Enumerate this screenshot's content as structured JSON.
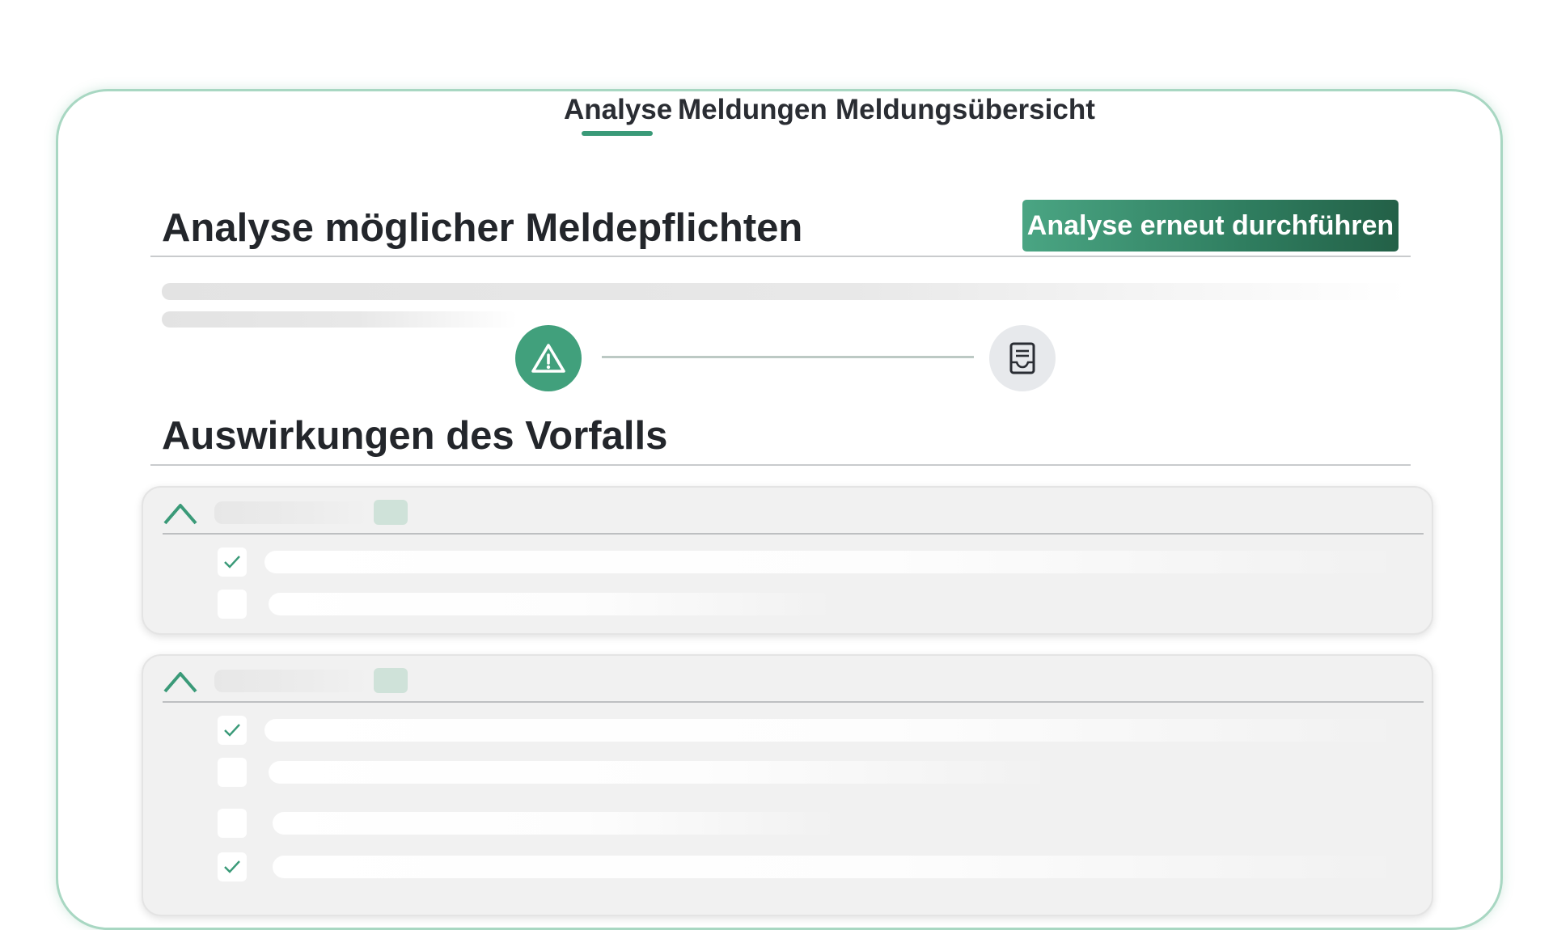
{
  "tabs": [
    {
      "label": "Analyse",
      "active": true
    },
    {
      "label": "Meldungen",
      "active": false
    },
    {
      "label": "Meldungsübersicht",
      "active": false
    }
  ],
  "analysis": {
    "title": "Analyse möglicher Meldepflichten",
    "rerun_button": "Analyse erneut durchführen"
  },
  "stepper": {
    "steps": [
      {
        "icon": "warning-icon",
        "state": "active"
      },
      {
        "icon": "report-icon",
        "state": "inactive"
      }
    ]
  },
  "impact": {
    "title": "Auswirkungen des Vorfalls",
    "groups": [
      {
        "expanded": true,
        "items": [
          {
            "checked": true
          },
          {
            "checked": false
          }
        ]
      },
      {
        "expanded": true,
        "items": [
          {
            "checked": true
          },
          {
            "checked": false
          },
          {
            "checked": false
          },
          {
            "checked": true
          }
        ]
      }
    ]
  },
  "colors": {
    "accent": "#3a9a78",
    "button_dark": "#236047",
    "frame": "#a8d7c2",
    "inactive_step": "#e7e9ec"
  }
}
